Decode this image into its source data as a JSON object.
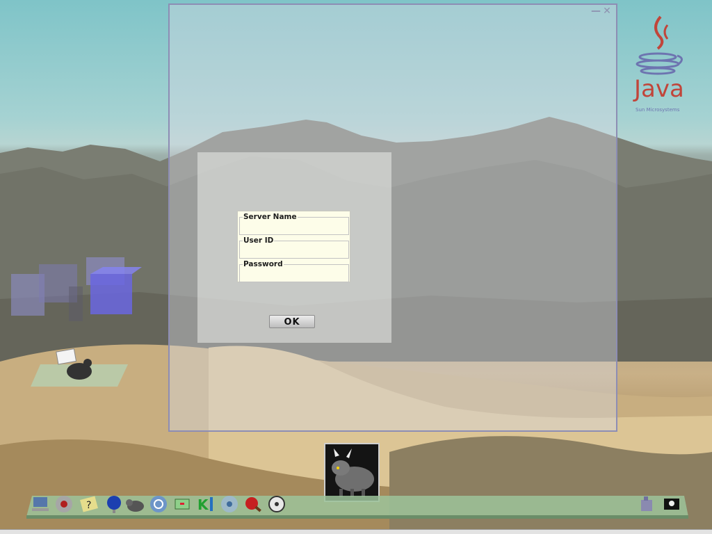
{
  "login_dialog": {
    "fields": [
      {
        "label": "Server Name",
        "value": ""
      },
      {
        "label": "User ID",
        "value": ""
      },
      {
        "label": "Password",
        "value": ""
      }
    ],
    "ok_label": "OK"
  },
  "desktop": {
    "java_logo": {
      "word": "Java",
      "company": "Sun Microsystems"
    }
  },
  "window_controls": {
    "minimize": "minimize-icon",
    "close": "close-icon"
  },
  "taskbar_icons": [
    "computer-icon",
    "disc-icon",
    "help-icon",
    "globe-icon",
    "goat-icon",
    "network-icon",
    "terminal-icon",
    "kde-icon",
    "cd-icon",
    "table-tennis-icon",
    "film-icon",
    "castle-icon",
    "pirate-flag-icon"
  ],
  "colors": {
    "window_border": "#8d8db4",
    "java_red": "#c1453a",
    "form_bg": "#fdfde9"
  }
}
